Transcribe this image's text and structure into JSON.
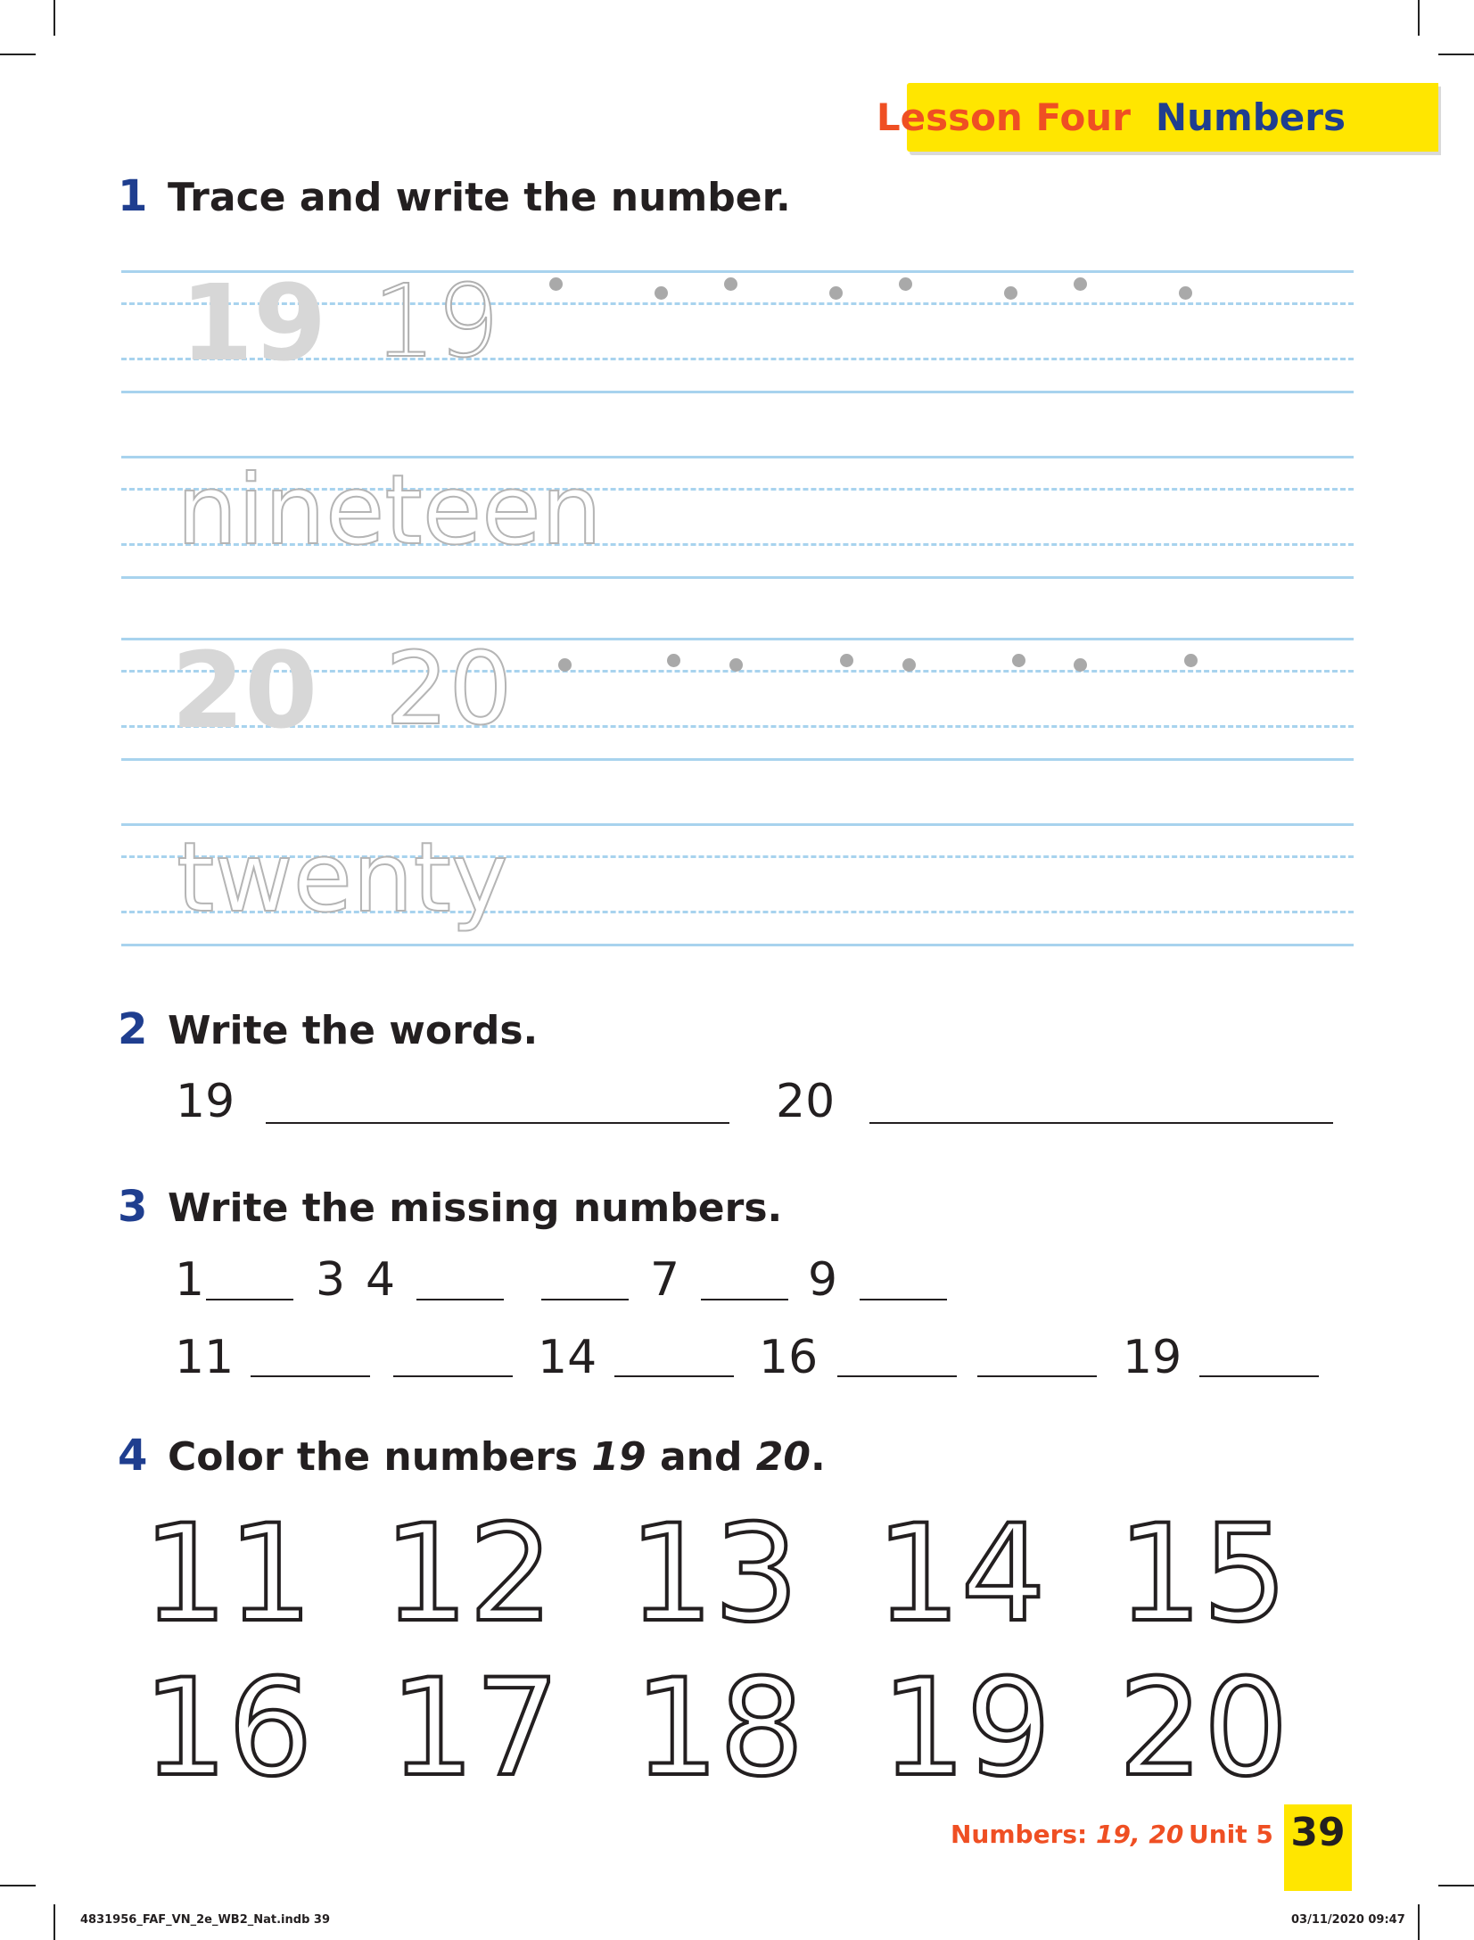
{
  "header": {
    "lesson": "Lesson Four",
    "topic": "Numbers"
  },
  "exercise1": {
    "number": "1",
    "title": "Trace and write the number.",
    "rows": [
      {
        "model": "19",
        "trace": "19"
      },
      {
        "model": "",
        "trace": "nineteen"
      },
      {
        "model": "20",
        "trace": "20"
      },
      {
        "model": "",
        "trace": "twenty"
      }
    ]
  },
  "exercise2": {
    "number": "2",
    "title": "Write the words.",
    "prompts": [
      "19",
      "20"
    ]
  },
  "exercise3": {
    "number": "3",
    "title": "Write the missing numbers.",
    "row1": [
      "1",
      "3",
      "4",
      "7",
      "9"
    ],
    "row2": [
      "11",
      "14",
      "16",
      "19"
    ]
  },
  "exercise4": {
    "number": "4",
    "title_start": "Color the numbers ",
    "title_n1": "19",
    "title_and": " and ",
    "title_n2": "20",
    "title_end": ".",
    "numbers_row1": [
      "11",
      "12",
      "13",
      "14",
      "15"
    ],
    "numbers_row2": [
      "16",
      "17",
      "18",
      "19",
      "20"
    ]
  },
  "footer": {
    "topic_label": "Numbers:",
    "topic_values": "19, 20",
    "unit": "Unit 5",
    "page": "39",
    "slug_file": "4831956_FAF_VN_2e_WB2_Nat.indb  39",
    "slug_date": "03/11/2020  09:47"
  },
  "colors": {
    "title_blue": "#1f3e8f",
    "accent_orange": "#ef4f23",
    "banner_yellow": "#ffe600",
    "line_blue": "#a8d3ee"
  }
}
